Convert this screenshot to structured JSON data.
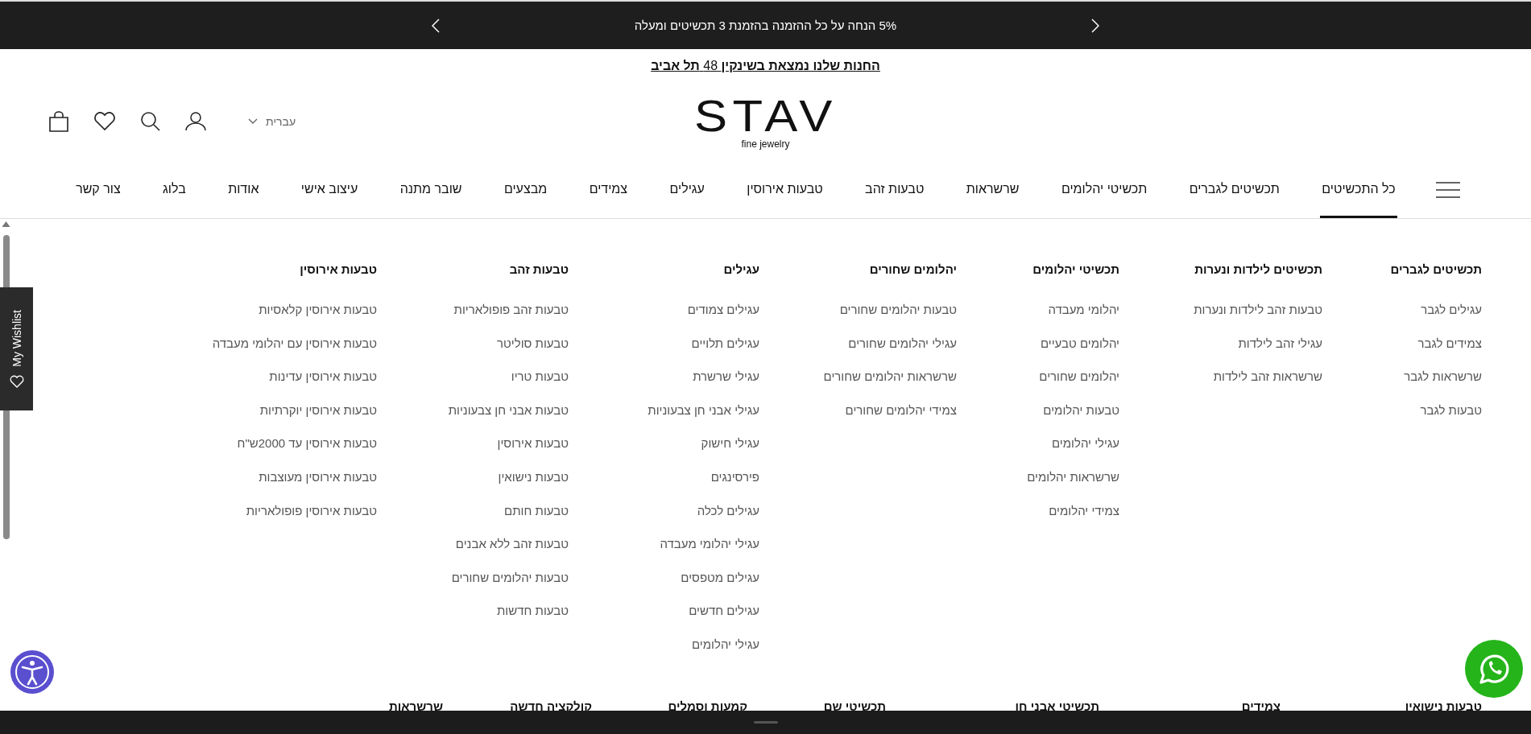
{
  "promo_bar": {
    "text": "5% הנחה על כל ההזמנה בהזמנת 3 תכשיטים ומעלה"
  },
  "store_notice": {
    "text": "**החנות שלנו נמצאת בשינקין** 48 **תל אביב**"
  },
  "logo": {
    "wordmark": "STAV",
    "tagline": "fine jewelry"
  },
  "language": {
    "label": "עברית"
  },
  "nav": [
    {
      "label": "כל התכשיטים",
      "selected": true
    },
    {
      "label": "תכשיטים לגברים",
      "selected": false
    },
    {
      "label": "תכשיטי יהלומים",
      "selected": false
    },
    {
      "label": "שרשראות",
      "selected": false
    },
    {
      "label": "טבעות זהב",
      "selected": false
    },
    {
      "label": "טבעות אירוסין",
      "selected": false
    },
    {
      "label": "עגילים",
      "selected": false
    },
    {
      "label": "צמידים",
      "selected": false
    },
    {
      "label": "מבצעים",
      "selected": false
    },
    {
      "label": "שובר מתנה",
      "selected": false
    },
    {
      "label": "עיצוב אישי",
      "selected": false
    },
    {
      "label": "אודות",
      "selected": false
    },
    {
      "label": "בלוג",
      "selected": false
    },
    {
      "label": "צור קשר",
      "selected": false
    }
  ],
  "mega_menu": {
    "columns": [
      {
        "heading": "תכשיטים לגברים",
        "items": [
          "עגילים לגבר",
          "צמידים לגבר",
          "שרשראות לגבר",
          "טבעות לגבר"
        ]
      },
      {
        "heading": "תכשיטים לילדות ונערות",
        "items": [
          "טבעות זהב לילדות ונערות",
          "עגילי זהב לילדות",
          "שרשראות זהב לילדות"
        ]
      },
      {
        "heading": "תכשיטי יהלומים",
        "items": [
          "יהלומי מעבדה",
          "יהלומים טבעיים",
          "יהלומים שחורים",
          "טבעות יהלומים",
          "עגילי יהלומים",
          "שרשראות יהלומים",
          "צמידי יהלומים"
        ]
      },
      {
        "heading": "יהלומים שחורים",
        "items": [
          "טבעות יהלומים שחורים",
          "עגילי יהלומים שחורים",
          "שרשראות יהלומים שחורים",
          "צמידי יהלומים שחורים"
        ]
      },
      {
        "heading": "עגילים",
        "items": [
          "עגילים צמודים",
          "עגילים תלויים",
          "עגילי שרשרת",
          "עגילי אבני חן צבעוניות",
          "עגילי חישוק",
          "פירסינגים",
          "עגילים לכלה",
          "עגילי יהלומי מעבדה",
          "עגילים מטפסים",
          "עגילים חדשים",
          "עגילי יהלומים"
        ]
      },
      {
        "heading": "טבעות זהב",
        "items": [
          "טבעות זהב פופולאריות",
          "טבעות סוליטר",
          "טבעות טריו",
          "טבעות אבני חן צבעוניות",
          "טבעות אירוסין",
          "טבעות נישואין",
          "טבעות חותם",
          "טבעות זהב ללא אבנים",
          "טבעות יהלומים שחורים",
          "טבעות חדשות"
        ]
      },
      {
        "heading": "טבעות אירוסין",
        "items": [
          "טבעות אירוסין קלאסיות",
          "טבעות אירוסין עם יהלומי מעבדה",
          "טבעות אירוסין עדינות",
          "טבעות אירוסין יוקרתיות",
          "טבעות אירוסין עד 2000ש\"ח",
          "טבעות אירוסין מעוצבות",
          "טבעות אירוסין פופולאריות"
        ]
      }
    ],
    "next_row_headings": [
      "טבעות נישואין",
      "צמידים",
      "תכשיטי אבני חן",
      "תכשיטי שם",
      "קמעות וסמלים",
      "קולקציה חדשה",
      "שרשראות"
    ]
  },
  "wishlist_tab": {
    "label": "My Wishlist"
  }
}
